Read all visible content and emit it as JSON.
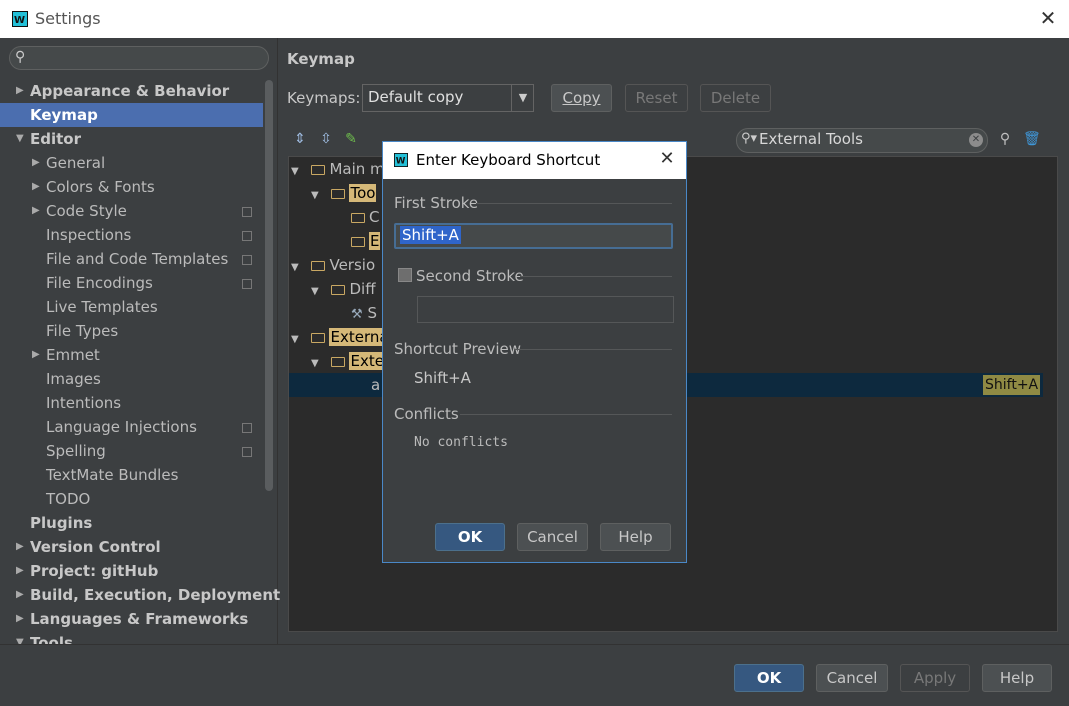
{
  "window": {
    "title": "Settings"
  },
  "sidebar": {
    "search_placeholder": "",
    "items": [
      {
        "label": "Appearance & Behavior",
        "expand": "right"
      },
      {
        "label": "Keymap"
      },
      {
        "label": "Editor",
        "expand": "down"
      },
      {
        "label": "General",
        "expand": "right"
      },
      {
        "label": "Colors & Fonts",
        "expand": "right"
      },
      {
        "label": "Code Style",
        "expand": "right"
      },
      {
        "label": "Inspections"
      },
      {
        "label": "File and Code Templates"
      },
      {
        "label": "File Encodings"
      },
      {
        "label": "Live Templates"
      },
      {
        "label": "File Types"
      },
      {
        "label": "Emmet",
        "expand": "right"
      },
      {
        "label": "Images"
      },
      {
        "label": "Intentions"
      },
      {
        "label": "Language Injections"
      },
      {
        "label": "Spelling"
      },
      {
        "label": "TextMate Bundles"
      },
      {
        "label": "TODO"
      },
      {
        "label": "Plugins"
      },
      {
        "label": "Version Control",
        "expand": "right"
      },
      {
        "label": "Project: gitHub",
        "expand": "right"
      },
      {
        "label": "Build, Execution, Deployment",
        "expand": "right"
      },
      {
        "label": "Languages & Frameworks",
        "expand": "right"
      },
      {
        "label": "Tools",
        "expand": "down"
      }
    ]
  },
  "keymap": {
    "heading": "Keymap",
    "keymaps_label": "Keymaps:",
    "selected_keymap": "Default copy",
    "copy_label": "Copy",
    "reset_label": "Reset",
    "delete_label": "Delete",
    "filter_value": "External Tools",
    "tree": [
      {
        "label": "Main m"
      },
      {
        "label": "Too"
      },
      {
        "label": "C"
      },
      {
        "label": "E"
      },
      {
        "label": "Versio"
      },
      {
        "label": "Diff"
      },
      {
        "label": "S"
      },
      {
        "label": "Externa"
      },
      {
        "label": "Exte"
      },
      {
        "label": "a"
      }
    ],
    "selected_shortcut": "Shift+A"
  },
  "dialog": {
    "title": "Enter Keyboard Shortcut",
    "first_stroke_label": "First Stroke",
    "first_stroke_value": "Shift+A",
    "second_stroke_label": "Second Stroke",
    "second_stroke_value": "",
    "preview_label": "Shortcut Preview",
    "preview_value": "Shift+A",
    "conflicts_label": "Conflicts",
    "conflicts_value": "No conflicts",
    "ok_label": "OK",
    "cancel_label": "Cancel",
    "help_label": "Help"
  },
  "footer": {
    "ok_label": "OK",
    "cancel_label": "Cancel",
    "apply_label": "Apply",
    "help_label": "Help"
  },
  "colors": {
    "accent_blue": "#4b6eaf",
    "default_button": "#365880",
    "highlight": "#d5b878",
    "dialog_border": "#4a88c7"
  }
}
